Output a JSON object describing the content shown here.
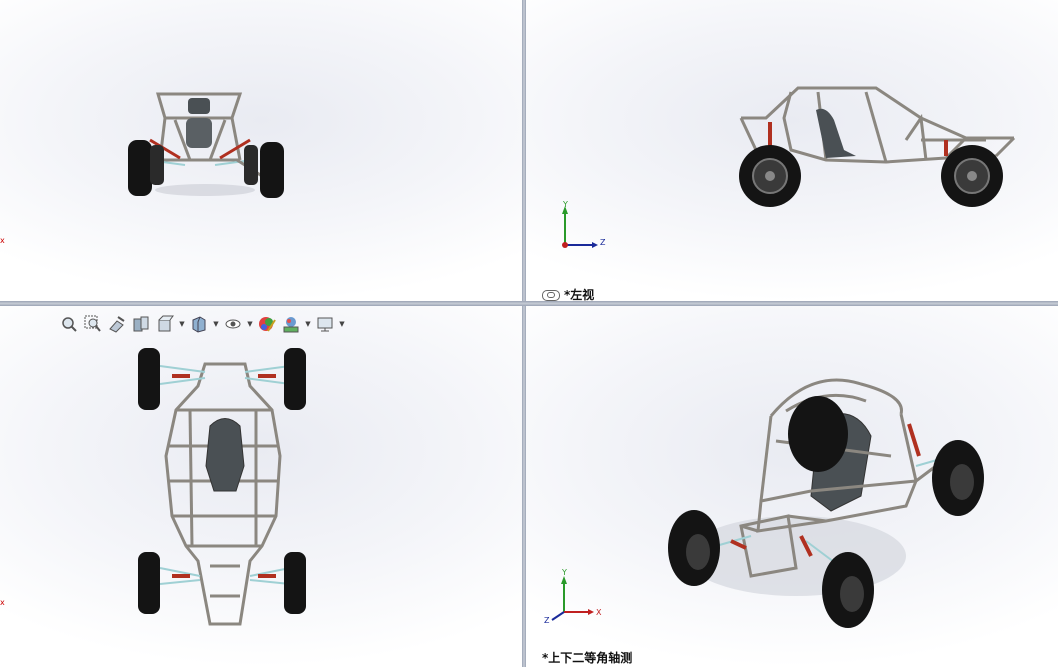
{
  "viewports": {
    "top_left": {
      "label": "",
      "axis_marker": "x"
    },
    "top_right": {
      "label": "*左视",
      "triad": {
        "y": "Y",
        "z": "Z"
      }
    },
    "bottom_left": {
      "label": "",
      "axis_marker": "x"
    },
    "bottom_right": {
      "label": "*上下二等角轴测",
      "triad": {
        "y": "Y",
        "z": "Z",
        "x": "X"
      }
    }
  },
  "heads_up_toolbar": {
    "items": [
      "zoom-to-fit-icon",
      "zoom-to-area-icon",
      "previous-view-icon",
      "section-view-icon",
      "view-orientation-icon",
      "display-style-icon",
      "hide-show-icon",
      "edit-appearance-icon",
      "apply-scene-icon",
      "view-settings-icon"
    ]
  },
  "colors": {
    "frame": "#c9c6c0",
    "tire": "#141414",
    "rim": "#5a5a5a",
    "spring": "#b03020",
    "arm": "#9fd0d4",
    "seat": "#4a5054"
  }
}
